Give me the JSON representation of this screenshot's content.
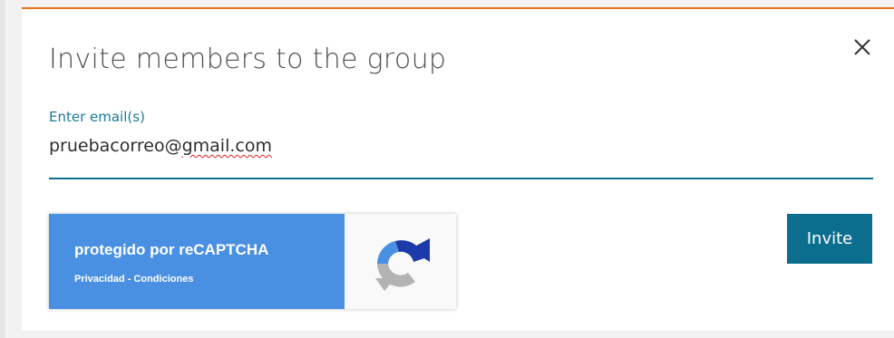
{
  "dialog": {
    "title": "Invite members to the group",
    "close_icon": "close-icon",
    "accent_color": "#e9711c"
  },
  "email_field": {
    "label": "Enter email(s)",
    "value_prefix": "pruebacorreo@",
    "value_misspelled": "gmail.com",
    "underline_color": "#0c6e8e",
    "label_color": "#1a7b9b"
  },
  "recaptcha": {
    "title": "protegido por reCAPTCHA",
    "privacy_link": "Privacidad",
    "separator": " - ",
    "terms_link": "Condiciones",
    "logo_icon": "recaptcha-logo-icon",
    "panel_color": "#4a90e2"
  },
  "actions": {
    "invite_label": "Invite",
    "invite_color": "#0b6e8e"
  }
}
